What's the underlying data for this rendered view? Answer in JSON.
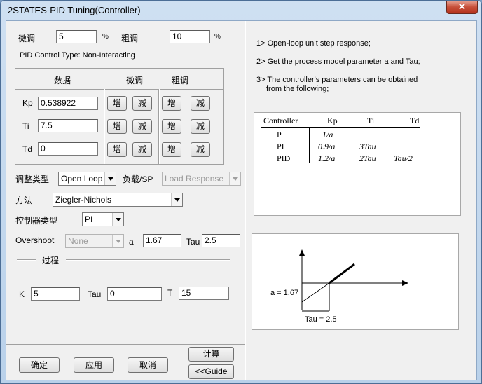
{
  "window": {
    "title": "2STATES-PID Tuning(Controller)",
    "close_glyph": "✕"
  },
  "fine": {
    "label": "微调",
    "value": "5",
    "unit": "%"
  },
  "coarse": {
    "label": "粗调",
    "value": "10",
    "unit": "%"
  },
  "control_type": "PID Control Type: Non-Interacting",
  "grid": {
    "col_data": "数据",
    "col_fine": "微调",
    "col_coarse": "粗调",
    "rows": [
      {
        "name": "Kp",
        "value": "0.538922"
      },
      {
        "name": "Ti",
        "value": "7.5"
      },
      {
        "name": "Td",
        "value": "0"
      }
    ],
    "inc": "增",
    "dec": "减"
  },
  "tuning_type": {
    "label": "调整类型",
    "value": "Open Loop"
  },
  "load_sp": {
    "label": "负载/SP",
    "value": "Load Response"
  },
  "method": {
    "label": "方法",
    "value": "Ziegler-Nichols"
  },
  "controller_type": {
    "label": "控制器类型",
    "value": "PI"
  },
  "overshoot": {
    "label": "Overshoot",
    "value": "None"
  },
  "a_param": {
    "label": "a",
    "value": "1.67"
  },
  "tau_param": {
    "label": "Tau",
    "value": "2.5"
  },
  "process": {
    "label": "过程"
  },
  "process_k": {
    "label": "K",
    "value": "5"
  },
  "process_tau": {
    "label": "Tau",
    "value": "0"
  },
  "process_t": {
    "label": "T",
    "value": "15"
  },
  "buttons": {
    "ok": "确定",
    "apply": "应用",
    "cancel": "取消",
    "compute": "计算",
    "guide": "<<Guide"
  },
  "instructions": {
    "step1": "1> Open-loop unit step response;",
    "step2": "2> Get the process model parameter a and Tau;",
    "step3a": "3> The controller's parameters can be obtained",
    "step3b": "from the following;"
  },
  "formula_table": {
    "headers": [
      "Controller",
      "Kp",
      "Ti",
      "Td"
    ],
    "rows": [
      {
        "controller": "P",
        "kp": "1/a",
        "ti": "",
        "td": ""
      },
      {
        "controller": "PI",
        "kp": "0.9/a",
        "ti": "3Tau",
        "td": ""
      },
      {
        "controller": "PID",
        "kp": "1.2/a",
        "ti": "2Tau",
        "td": "Tau/2"
      }
    ]
  },
  "diagram": {
    "a_label": "a = 1.67",
    "tau_label": "Tau = 2.5"
  }
}
